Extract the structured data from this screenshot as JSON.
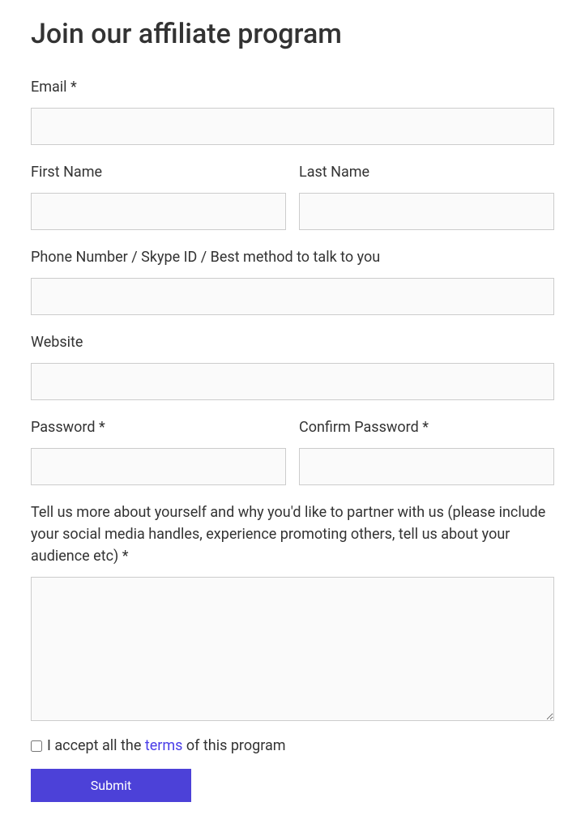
{
  "title": "Join our affiliate program",
  "fields": {
    "email": {
      "label": "Email *"
    },
    "first_name": {
      "label": "First Name"
    },
    "last_name": {
      "label": "Last Name"
    },
    "phone": {
      "label": "Phone Number / Skype ID / Best method to talk to you"
    },
    "website": {
      "label": "Website"
    },
    "password": {
      "label": "Password *"
    },
    "confirm_password": {
      "label": "Confirm Password *"
    },
    "about": {
      "label": "Tell us more about yourself and why you'd like to partner with us (please include your social media handles, experience promoting others, tell us about your audience etc) *"
    }
  },
  "terms": {
    "prefix": "I accept all the ",
    "link_text": "terms",
    "suffix": " of this program"
  },
  "submit_label": "Submit"
}
